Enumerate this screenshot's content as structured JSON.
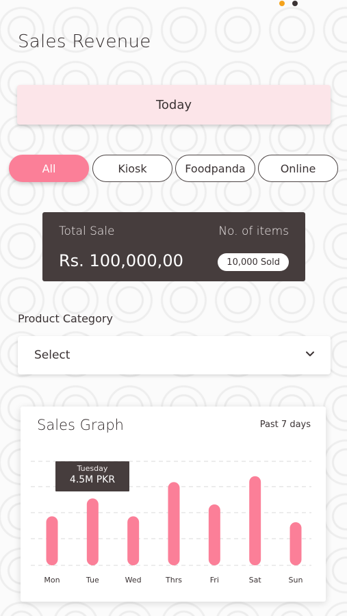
{
  "header": {
    "title": "Sales Revenue"
  },
  "period": {
    "label": "Today"
  },
  "channels": [
    {
      "label": "All",
      "active": true
    },
    {
      "label": "Kiosk",
      "active": false
    },
    {
      "label": "Foodpanda",
      "active": false
    },
    {
      "label": "Online",
      "active": false
    }
  ],
  "summary": {
    "total_label": "Total Sale",
    "total_value": "Rs. 100,000,00",
    "items_label": "No. of items",
    "items_value": "10,000 Sold"
  },
  "category": {
    "label": "Product Category",
    "selected": "Select",
    "icon": "chevron-down-icon"
  },
  "graph": {
    "title": "Sales Graph",
    "period": "Past 7 days",
    "tooltip": {
      "day": "Tuesday",
      "value": "4.5M PKR"
    }
  },
  "colors": {
    "accent": "#fb7f98",
    "dark": "#463d3d",
    "pink_light": "#fce5e9"
  },
  "chart_data": {
    "type": "bar",
    "categories": [
      "Mon",
      "Tue",
      "Wed",
      "Thrs",
      "Fri",
      "Sat",
      "Sun"
    ],
    "values": [
      3.3,
      4.5,
      3.3,
      5.6,
      4.1,
      6.0,
      2.9
    ],
    "ylim": [
      0,
      7
    ],
    "grid": true
  }
}
